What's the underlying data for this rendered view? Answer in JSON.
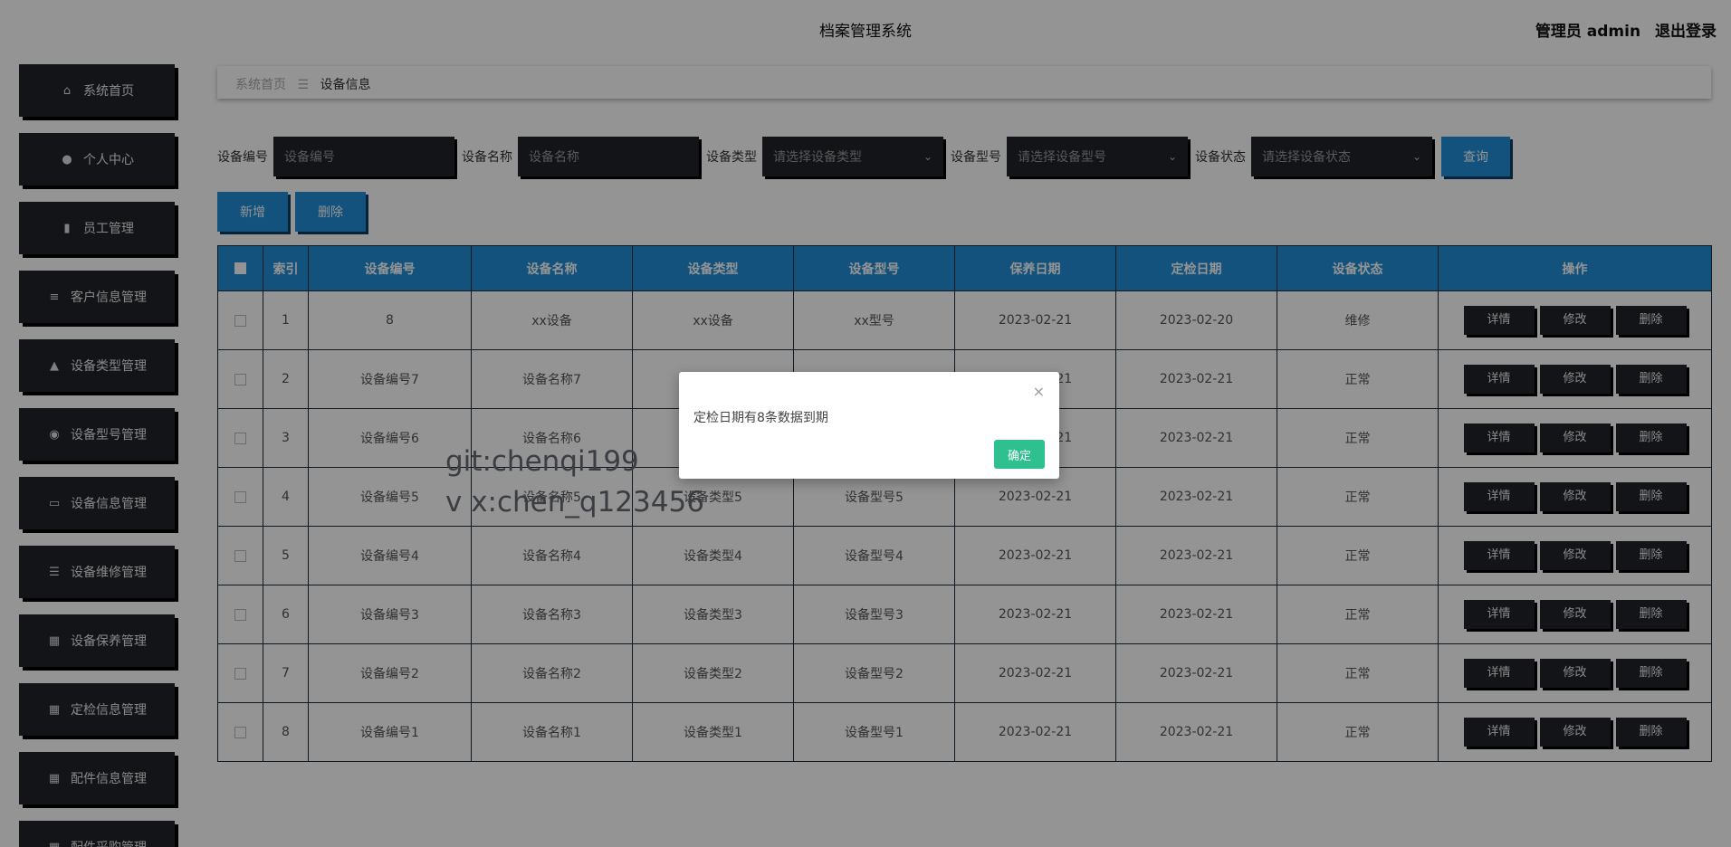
{
  "header": {
    "title": "档案管理系统",
    "user": "管理员 admin",
    "logout": "退出登录"
  },
  "sidebar": {
    "items": [
      {
        "label": "系统首页",
        "icon": "home-icon"
      },
      {
        "label": "个人中心",
        "icon": "user-icon"
      },
      {
        "label": "员工管理",
        "icon": "bar-chart-icon"
      },
      {
        "label": "客户信息管理",
        "icon": "sliders-icon"
      },
      {
        "label": "设备类型管理",
        "icon": "person-icon"
      },
      {
        "label": "设备型号管理",
        "icon": "bulb-icon"
      },
      {
        "label": "设备信息管理",
        "icon": "monitor-icon"
      },
      {
        "label": "设备维修管理",
        "icon": "list-icon"
      },
      {
        "label": "设备保养管理",
        "icon": "grid-icon"
      },
      {
        "label": "定检信息管理",
        "icon": "grid-icon"
      },
      {
        "label": "配件信息管理",
        "icon": "grid-icon"
      },
      {
        "label": "配件采购管理",
        "icon": "grid-icon"
      }
    ]
  },
  "breadcrumb": {
    "home": "系统首页",
    "sep": "☰",
    "current": "设备信息"
  },
  "filters": [
    {
      "label": "设备编号",
      "placeholder": "设备编号",
      "type": "input"
    },
    {
      "label": "设备名称",
      "placeholder": "设备名称",
      "type": "input"
    },
    {
      "label": "设备类型",
      "placeholder": "请选择设备类型",
      "type": "select"
    },
    {
      "label": "设备型号",
      "placeholder": "请选择设备型号",
      "type": "select"
    },
    {
      "label": "设备状态",
      "placeholder": "请选择设备状态",
      "type": "select"
    }
  ],
  "buttons": {
    "query": "查询",
    "add": "新增",
    "delete": "删除"
  },
  "table": {
    "headers": [
      "索引",
      "设备编号",
      "设备名称",
      "设备类型",
      "设备型号",
      "保养日期",
      "定检日期",
      "设备状态",
      "操作"
    ],
    "rows": [
      [
        "1",
        "8",
        "xx设备",
        "xx设备",
        "xx型号",
        "2023-02-21",
        "2023-02-20",
        "维修"
      ],
      [
        "2",
        "设备编号7",
        "设备名称7",
        "",
        "",
        "2023-02-21",
        "2023-02-21",
        "正常"
      ],
      [
        "3",
        "设备编号6",
        "设备名称6",
        "",
        "",
        "2023-02-21",
        "2023-02-21",
        "正常"
      ],
      [
        "4",
        "设备编号5",
        "设备名称5",
        "设备类型5",
        "设备型号5",
        "2023-02-21",
        "2023-02-21",
        "正常"
      ],
      [
        "5",
        "设备编号4",
        "设备名称4",
        "设备类型4",
        "设备型号4",
        "2023-02-21",
        "2023-02-21",
        "正常"
      ],
      [
        "6",
        "设备编号3",
        "设备名称3",
        "设备类型3",
        "设备型号3",
        "2023-02-21",
        "2023-02-21",
        "正常"
      ],
      [
        "7",
        "设备编号2",
        "设备名称2",
        "设备类型2",
        "设备型号2",
        "2023-02-21",
        "2023-02-21",
        "正常"
      ],
      [
        "8",
        "设备编号1",
        "设备名称1",
        "设备类型1",
        "设备型号1",
        "2023-02-21",
        "2023-02-21",
        "正常"
      ]
    ],
    "row_actions": [
      "详情",
      "修改",
      "删除"
    ]
  },
  "watermark": {
    "line1": "git:chenqi199",
    "line2": "v x:chen_q123456"
  },
  "dialog": {
    "message": "定检日期有8条数据到期",
    "ok": "确定",
    "close": "×"
  }
}
